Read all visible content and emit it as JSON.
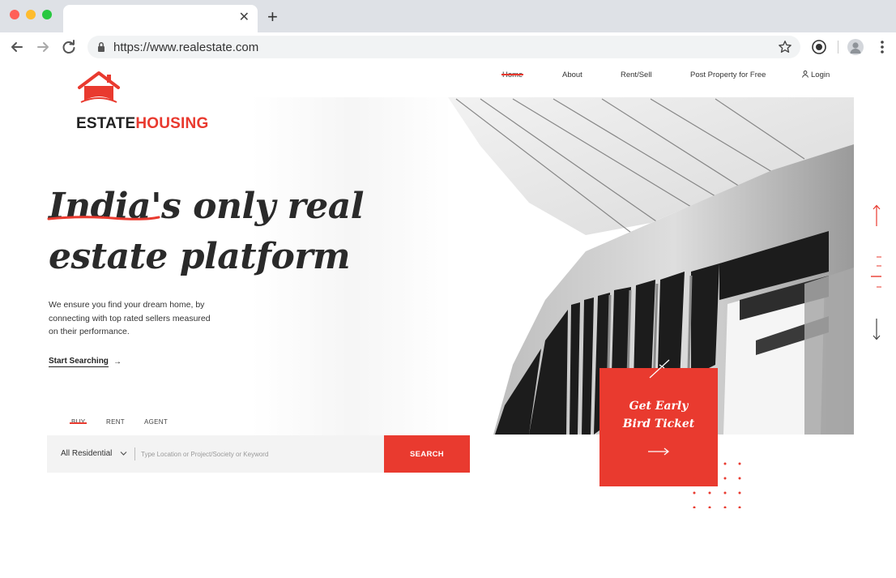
{
  "browser": {
    "url": "https://www.realestate.com",
    "icons": [
      "back-icon",
      "forward-icon",
      "reload-icon",
      "lock-icon",
      "star-icon",
      "extension-icon",
      "avatar",
      "menu-icon",
      "close-icon",
      "plus-icon"
    ]
  },
  "logo": {
    "text_a": "ESTATE",
    "text_b": "HOUSING"
  },
  "nav": {
    "home": "Home",
    "about": "About",
    "rent_sell": "Rent/Sell",
    "post": "Post Property for Free",
    "login": "Login"
  },
  "hero": {
    "line1_word": "India's",
    "line1_rest": " only real",
    "line2": "estate platform",
    "description": "We ensure you find your dream home, by connecting with top rated sellers measured on their performance.",
    "cta": "Start Searching",
    "cta_arrow": "→"
  },
  "search": {
    "tabs": {
      "buy": "BUY",
      "rent": "RENT",
      "agent": "AGENT"
    },
    "category": "All Residential",
    "placeholder": "Type Location or Project/Society or Keyword",
    "button": "SEARCH"
  },
  "ticket": {
    "line1": "Get Early",
    "line2": "Bird Ticket"
  },
  "colors": {
    "accent": "#e93a2f",
    "text": "#2a2a2a"
  }
}
